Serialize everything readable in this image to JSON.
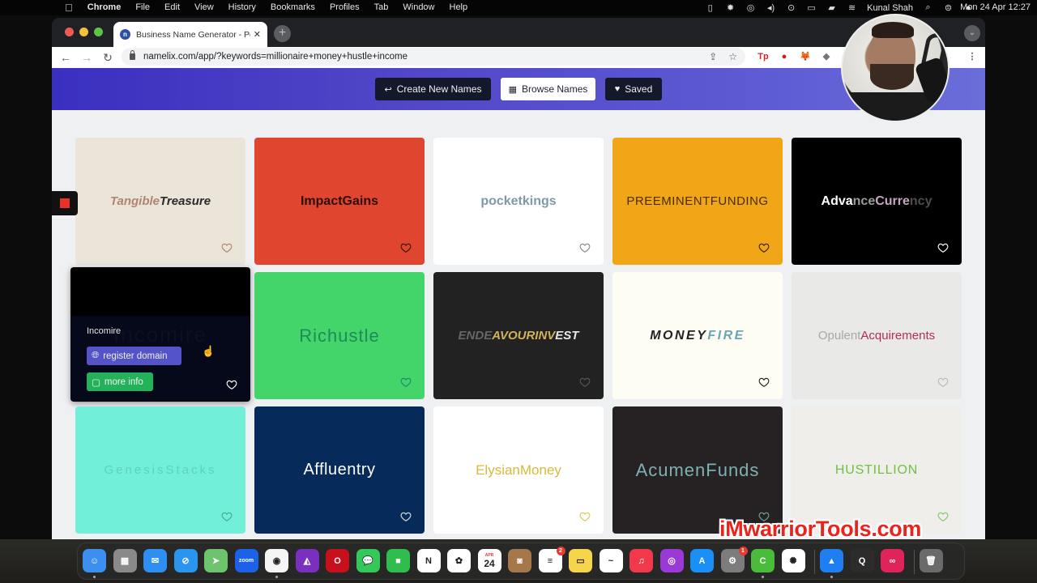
{
  "menubar": {
    "apple_icon": "apple-logo",
    "app_name": "Chrome",
    "menus": [
      "File",
      "Edit",
      "View",
      "History",
      "Bookmarks",
      "Profiles",
      "Tab",
      "Window",
      "Help"
    ],
    "status_icons": [
      "screen-recorder-icon",
      "brightness-icon",
      "creative-cloud-icon",
      "volume-icon",
      "play-icon",
      "display-icon",
      "battery-icon",
      "wifi-icon"
    ],
    "user_name": "Kunal Shah",
    "clock": "Mon 24 Apr  12:27"
  },
  "browser": {
    "tab": {
      "title": "Business Name Generator - Po",
      "favicon": "n"
    },
    "url": "namelix.com/app/?keywords=millionaire+money+hustle+income",
    "extensions": [
      {
        "name": "tp-extension",
        "label": "Tp",
        "color": "#d8242a"
      },
      {
        "name": "opera-adblock-extension",
        "label": "●",
        "color": "#cc1b1b"
      },
      {
        "name": "metamask-extension",
        "label": "🦊",
        "color": "#e2761b"
      },
      {
        "name": "puzzle-extension",
        "label": "◆",
        "color": "#777777"
      }
    ]
  },
  "nav": {
    "create_label": "Create New Names",
    "browse_label": "Browse Names",
    "saved_label": "Saved"
  },
  "cards": [
    {
      "name": "TangibleTreasure",
      "parts": [
        {
          "t": "Tangible",
          "c": "#b08570"
        },
        {
          "t": "Treasure",
          "c": "#2b2a28"
        }
      ],
      "bg": "#ebe4d9",
      "style": "italic-bold",
      "heart": "#b08570"
    },
    {
      "name": "ImpactGains",
      "parts": [
        {
          "t": "ImpactGains",
          "c": "#2a0f0c"
        }
      ],
      "bg": "#e0452f",
      "style": "bold",
      "heart": "#3a1410"
    },
    {
      "name": "pocketkings",
      "parts": [
        {
          "t": "pocketkings",
          "c": "#7e9aa6"
        }
      ],
      "bg": "#ffffff",
      "style": "bold",
      "heart": "#888888"
    },
    {
      "name": "PREEMINENTFUNDING",
      "parts": [
        {
          "t": "PREEMINENTFUNDING",
          "c": "#4a2b0a"
        }
      ],
      "bg": "#f0a616",
      "style": "thin-caps",
      "heart": "#3a2208"
    },
    {
      "name": "AdvanceCurrency",
      "parts": [
        {
          "t": "Adva",
          "c": "#ffffff"
        },
        {
          "t": "nce",
          "c": "#9a9a9a"
        },
        {
          "t": "Curre",
          "c": "#c6a4c2"
        },
        {
          "t": "ncy",
          "c": "#4d4d4d"
        }
      ],
      "bg": "#000000",
      "style": "bold",
      "heart": "#ffffff"
    },
    {
      "name": "Incomire",
      "parts": [
        {
          "t": "Incomire",
          "c": "#2b2f40"
        }
      ],
      "bg": "#000000",
      "style": "wide",
      "heart": "#ffffff",
      "hovered": true,
      "overlay": {
        "name": "Incomire",
        "register_label": "register domain",
        "info_label": "more info"
      }
    },
    {
      "name": "Richustle",
      "parts": [
        {
          "t": "Richustle",
          "c": "#1f8a5a"
        }
      ],
      "bg": "#43d46a",
      "style": "thin",
      "heart": "#1f8a6a"
    },
    {
      "name": "ENDEAVOURINVEST",
      "parts": [
        {
          "t": "ENDE",
          "c": "#666666"
        },
        {
          "t": "AVOURINV",
          "c": "#d2b25a"
        },
        {
          "t": "EST",
          "c": "#e8e8e8"
        }
      ],
      "bg": "#222222",
      "style": "italic-bold",
      "heart": "#555555"
    },
    {
      "name": "MONEYFIRE",
      "parts": [
        {
          "t": "MONEY",
          "c": "#222222"
        },
        {
          "t": "FIRE",
          "c": "#6aa7b4"
        }
      ],
      "bg": "#fdfdf3",
      "style": "italic-bold-spaced",
      "heart": "#222222"
    },
    {
      "name": "OpulentAcquirements",
      "parts": [
        {
          "t": "Opulent",
          "c": "#a8a8a8"
        },
        {
          "t": "Acquirements",
          "c": "#b22e55"
        }
      ],
      "bg": "#e9e9e7",
      "style": "regular",
      "heart": "#bbbbbb"
    },
    {
      "name": "GenesisStacks",
      "parts": [
        {
          "t": "GenesisStacks",
          "c": "#5fd1bd"
        }
      ],
      "bg": "#72efd8",
      "style": "thin-spaced",
      "heart": "#4aa78f"
    },
    {
      "name": "Affluentry",
      "parts": [
        {
          "t": "Affluentry",
          "c": "#ffffff"
        }
      ],
      "bg": "#062a5a",
      "style": "regular-lg",
      "heart": "#dddddd"
    },
    {
      "name": "ElysianMoney",
      "parts": [
        {
          "t": "ElysianMoney",
          "c": "#d8b93c"
        }
      ],
      "bg": "#ffffff",
      "style": "condensed",
      "heart": "#d6c85a"
    },
    {
      "name": "AcumenFunds",
      "parts": [
        {
          "t": "AcumenFunds",
          "c": "#7fb0b4"
        }
      ],
      "bg": "#262122",
      "style": "thin",
      "heart": "#6aa2a0"
    },
    {
      "name": "HUSTILLION",
      "parts": [
        {
          "t": "HUSTILLION",
          "c": "#6fc041"
        }
      ],
      "bg": "#efeeeb",
      "style": "regular-caps",
      "heart": "#8cc46a"
    }
  ],
  "overlays": {
    "recorder_icon": "stop-recording-icon",
    "watermark": "iMwarriorTools.com"
  },
  "dock": {
    "apps": [
      {
        "name": "finder",
        "label": "☺",
        "bg": "#3c8ff0"
      },
      {
        "name": "launchpad",
        "label": "▦",
        "bg": "#8a8a8a"
      },
      {
        "name": "mail",
        "label": "✉",
        "bg": "#2f8ef2"
      },
      {
        "name": "safari",
        "label": "⊘",
        "bg": "#2a95ee"
      },
      {
        "name": "maps",
        "label": "➤",
        "bg": "#6ec46c"
      },
      {
        "name": "zoom",
        "label": "zoom",
        "bg": "#1b62e8"
      },
      {
        "name": "chrome",
        "label": "◉",
        "bg": "#f5f5f5"
      },
      {
        "name": "affinity-photo",
        "label": "◭",
        "bg": "#7a2fbf"
      },
      {
        "name": "opera",
        "label": "O",
        "bg": "#c8101d"
      },
      {
        "name": "messages",
        "label": "💬",
        "bg": "#34c759"
      },
      {
        "name": "facetime",
        "label": "■",
        "bg": "#2fbd4d"
      },
      {
        "name": "notion",
        "label": "N",
        "bg": "#ffffff"
      },
      {
        "name": "photos",
        "label": "✿",
        "bg": "#ffffff"
      },
      {
        "name": "calendar",
        "label": "24",
        "bg": "#ffffff",
        "sub": "APR"
      },
      {
        "name": "contacts",
        "label": "◙",
        "bg": "#a5774a"
      },
      {
        "name": "reminders",
        "label": "≡",
        "bg": "#ffffff",
        "badge": "2"
      },
      {
        "name": "notes",
        "label": "▭",
        "bg": "#f7d54a"
      },
      {
        "name": "freeform",
        "label": "~",
        "bg": "#ffffff"
      },
      {
        "name": "music",
        "label": "♫",
        "bg": "#f2394c"
      },
      {
        "name": "podcasts",
        "label": "◎",
        "bg": "#9b39d6"
      },
      {
        "name": "app-store",
        "label": "A",
        "bg": "#1a8ff5"
      },
      {
        "name": "system-settings",
        "label": "⚙",
        "bg": "#7c7c7c",
        "badge": "1"
      },
      {
        "name": "camtasia",
        "label": "C",
        "bg": "#4bbb3b"
      },
      {
        "name": "cleanmymac",
        "label": "✺",
        "bg": "#ffffff"
      },
      {
        "name": "keynote",
        "label": "▲",
        "bg": "#1f7ff2"
      },
      {
        "name": "quicktime",
        "label": "Q",
        "bg": "#2c2c2c"
      },
      {
        "name": "creative-cloud",
        "label": "∞",
        "bg": "#e0245a"
      },
      {
        "name": "trash",
        "label": "🗑",
        "bg": "#6a6a6a"
      }
    ]
  }
}
